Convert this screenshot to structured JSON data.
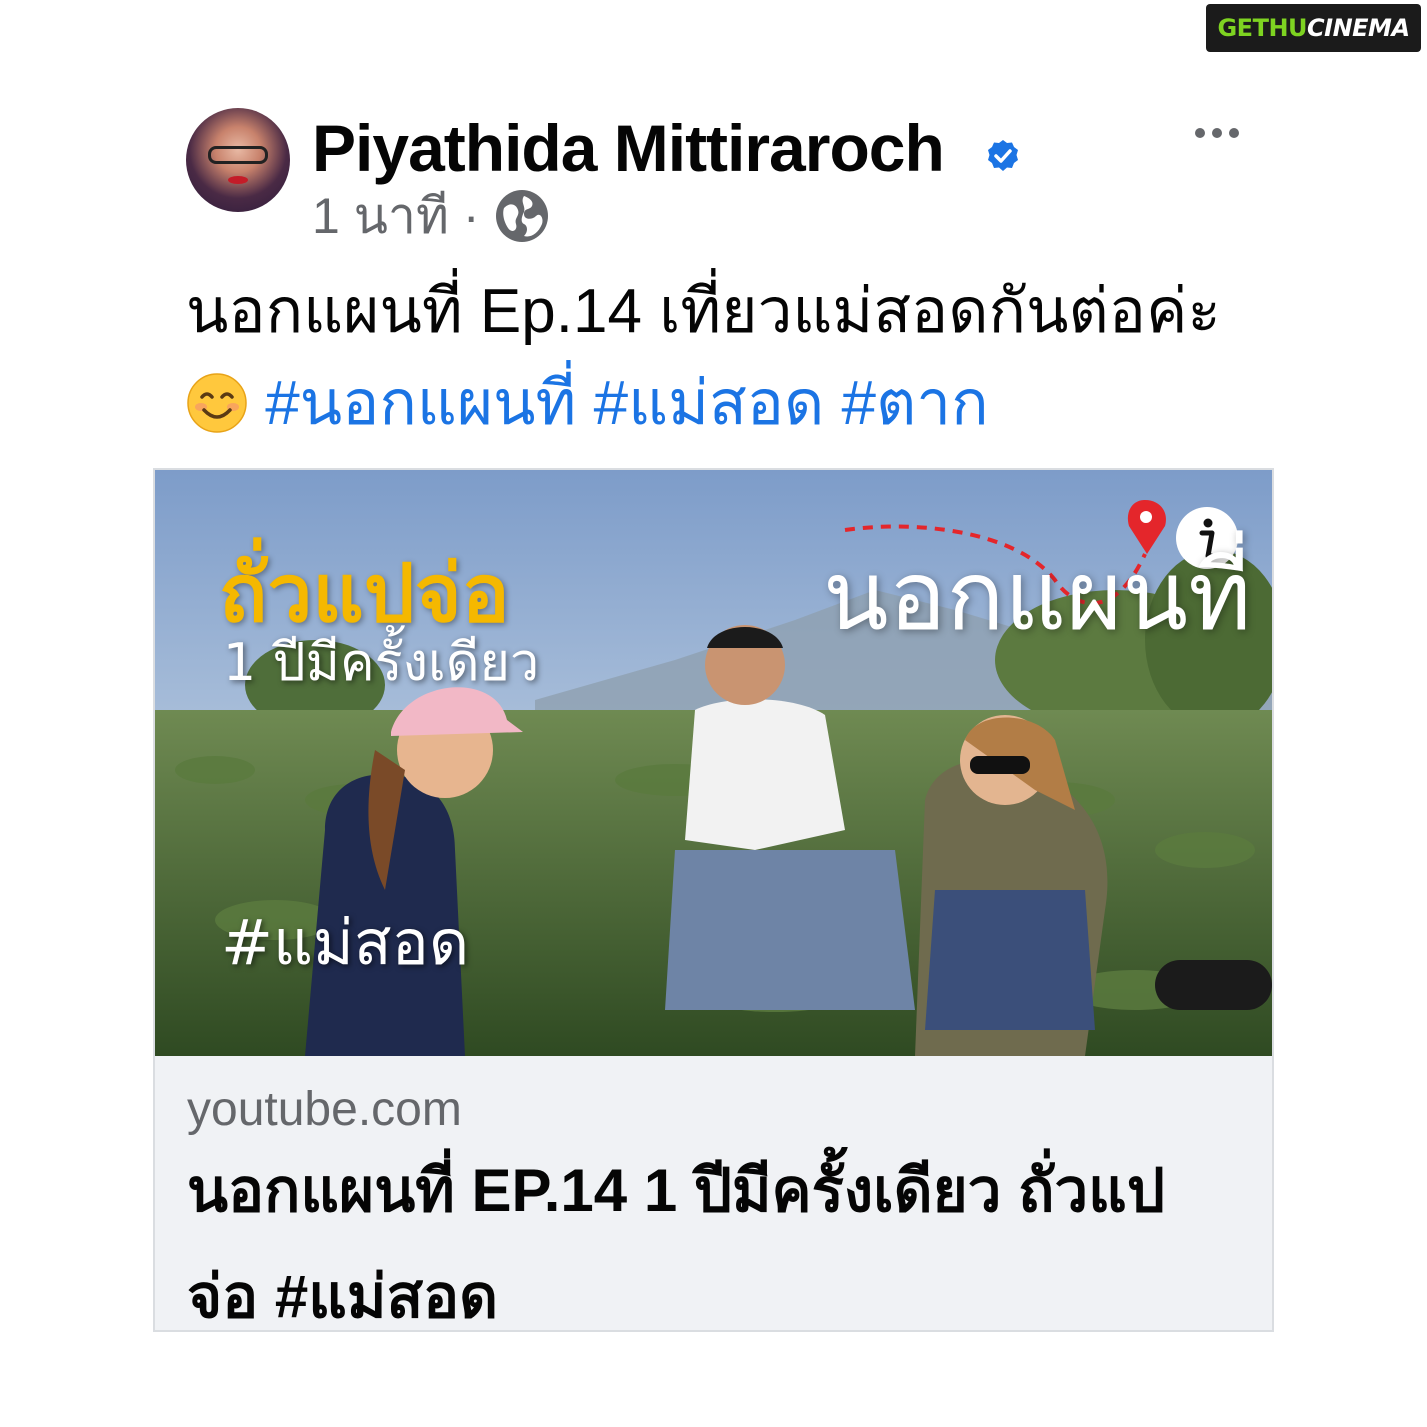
{
  "watermark": {
    "part1": "GETHU",
    "part2": "CINEMA"
  },
  "post": {
    "author": "Piyathida Mittiraroch",
    "verified_icon": "verified-badge-icon",
    "more_icon": "more-options-icon",
    "time": "1 นาที",
    "separator": "·",
    "privacy_icon": "globe-icon",
    "text_main": "นอกแผนที่ Ep.14 เที่ยวแม่สอดกันต่อค่ะ",
    "emoji": "smiling-face-icon",
    "hashtags": [
      "#นอกแผนที่",
      "#แม่สอด",
      "#ตาก"
    ],
    "hashtag_color": "#1b74e4"
  },
  "link_card": {
    "thumbnail": {
      "title": "ถั่วแปจ่อ",
      "subtitle": "1 ปีมีครั้งเดียว",
      "logo": "นอกแผนที่",
      "hashtag": "#แม่สอด",
      "info_icon": "info-icon",
      "title_color": "#f5b800"
    },
    "domain": "youtube.com",
    "title": "นอกแผนที่ EP.14 1 ปีมีครั้งเดียว ถั่วแปจ่อ #แม่สอด"
  }
}
